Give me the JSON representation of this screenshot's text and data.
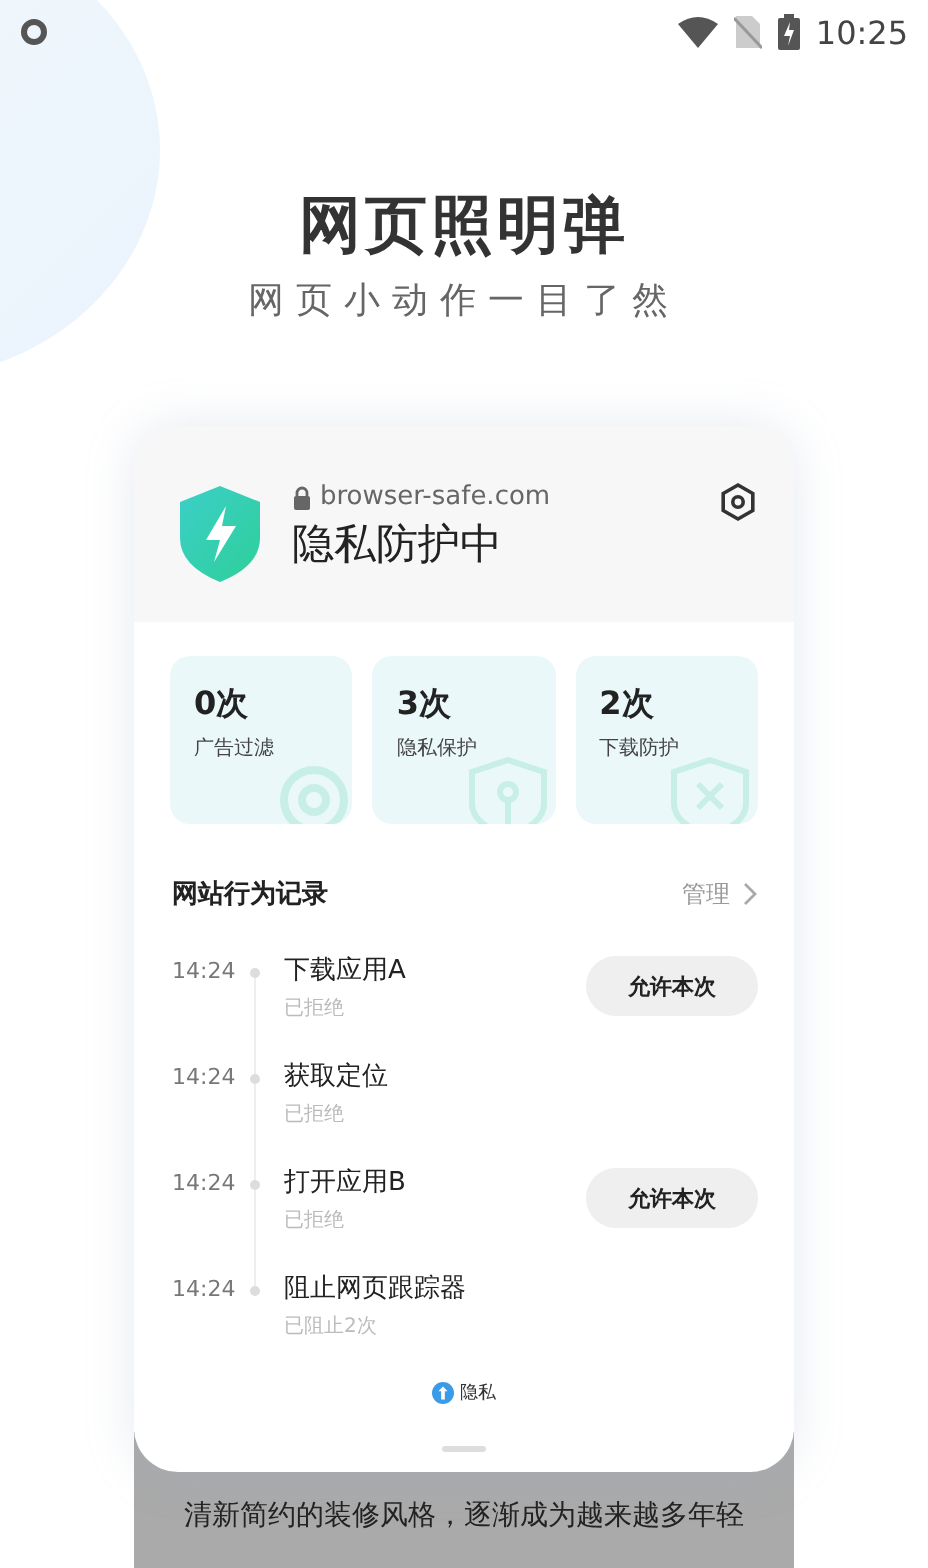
{
  "status_bar": {
    "time": "10:25"
  },
  "headline": {
    "title": "网页照明弹",
    "subtitle": "网页小动作一目了然"
  },
  "card": {
    "url": "browser-safe.com",
    "status": "隐私防护中",
    "stats": [
      {
        "value": "0次",
        "label": "广告过滤",
        "kind": "filter"
      },
      {
        "value": "3次",
        "label": "隐私保护",
        "kind": "privacy"
      },
      {
        "value": "2次",
        "label": "下载防护",
        "kind": "download"
      }
    ],
    "records": {
      "title": "网站行为记录",
      "manage": "管理",
      "items": [
        {
          "time": "14:24",
          "title": "下载应用A",
          "status": "已拒绝",
          "action": "允许本次"
        },
        {
          "time": "14:24",
          "title": "获取定位",
          "status": "已拒绝"
        },
        {
          "time": "14:24",
          "title": "打开应用B",
          "status": "已拒绝",
          "action": "允许本次"
        },
        {
          "time": "14:24",
          "title": "阻止网页跟踪器",
          "status": "已阻止2次"
        }
      ]
    },
    "footer": "隐私"
  },
  "caption": "清新简约的装修风格，逐渐成为越来越多年轻"
}
